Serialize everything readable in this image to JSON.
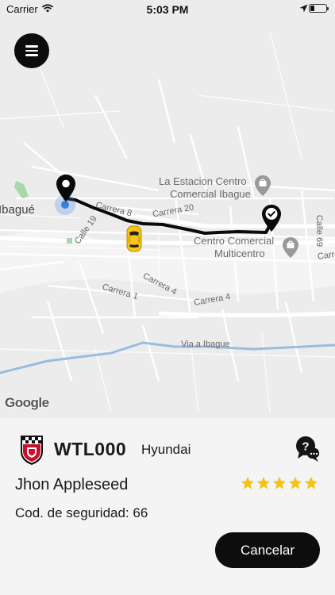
{
  "status_bar": {
    "carrier": "Carrier",
    "time": "5:03 PM"
  },
  "map": {
    "city": "Ibagué",
    "streets": [
      "Carrera 8",
      "Carrera 20",
      "Calle 19",
      "Calle 69",
      "Carrera 4",
      "Carrera 1",
      "Carrera 4",
      "Carre",
      "Via a Ibague"
    ],
    "pois": [
      {
        "name": "La Estacion Centro Comercial Ibague",
        "line1": "La Estacion Centro",
        "line2": "Comercial Ibague"
      },
      {
        "name": "Centro Comercial Multicentro",
        "line1": "Centro Comercial",
        "line2": "Multicentro"
      }
    ],
    "attribution": "Google",
    "colors": {
      "route": "#0a0a0a",
      "water": "#9bbbe0",
      "park": "#a8d8a8",
      "car": "#f5c518",
      "origin_dot": "#3b7ddd"
    }
  },
  "menu": {
    "icon": "hamburger-menu-icon"
  },
  "trip": {
    "plate": "WTL000",
    "brand": "Hyundai",
    "driver_name": "Jhon Appleseed",
    "security_code": "Cod. de seguridad: 66",
    "rating": 5,
    "rating_max": 5,
    "star_color": "#f6c11b",
    "cancel_label": "Cancelar"
  }
}
